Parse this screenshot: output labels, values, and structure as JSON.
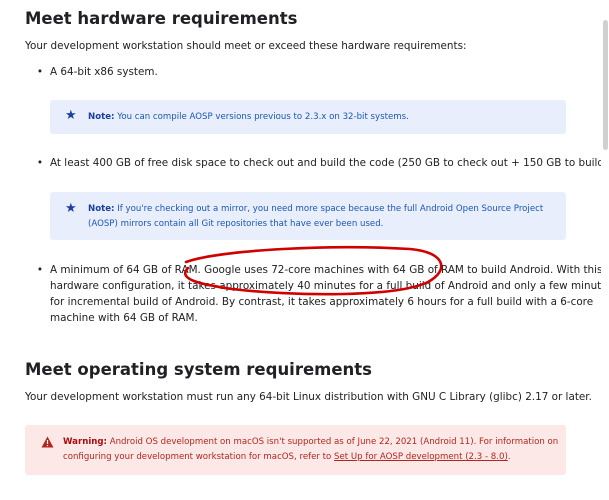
{
  "hardware": {
    "heading": "Meet hardware requirements",
    "intro": "Your development workstation should meet or exceed these hardware requirements:",
    "bullet_symbol": "•",
    "item1": "A 64-bit x86 system.",
    "note1_label": "Note:",
    "note1_text": "You can compile AOSP versions previous to 2.3.x on 32-bit systems.",
    "item2": "At least 400 GB of free disk space to check out and build the code (250 GB to check out + 150 GB to build).",
    "note2_label": "Note:",
    "note2_line1": "If you're checking out a mirror, you need more space because the full Android Open Source Project",
    "note2_line2": "(AOSP) mirrors contain all Git repositories that have ever been used.",
    "item3_line1": "A minimum of 64 GB of RAM. Google uses 72-core machines with 64 GB of RAM to build Android. With this",
    "item3_line2": "hardware configuration, it takes approximately 40 minutes for a full build of Android and only a few minutes",
    "item3_line3": "for incremental build of Android. By contrast, it takes approximately 6 hours for a full build with a 6-core",
    "item3_line4": "machine with 64 GB of RAM."
  },
  "os": {
    "heading": "Meet operating system requirements",
    "intro": "Your development workstation must run any 64-bit Linux distribution with GNU C Library (glibc) 2.17 or later.",
    "warning_label": "Warning:",
    "warning_line1": "Android OS development on macOS isn't supported as of June 22, 2021 (Android 11). For information on",
    "warning_line2_prefix": "configuring your development workstation for macOS, refer to ",
    "warning_link": "Set Up for AOSP development (2.3 - 8.0)",
    "warning_line2_suffix": "."
  },
  "icons": {
    "note_icon": "star-icon",
    "warning_icon": "warning-triangle-icon"
  },
  "colors": {
    "note_bg": "#e8eefc",
    "note_text": "#1a57b5",
    "warning_bg": "#fce8e6",
    "warning_text": "#b3261e",
    "annotation": "#d00000"
  }
}
